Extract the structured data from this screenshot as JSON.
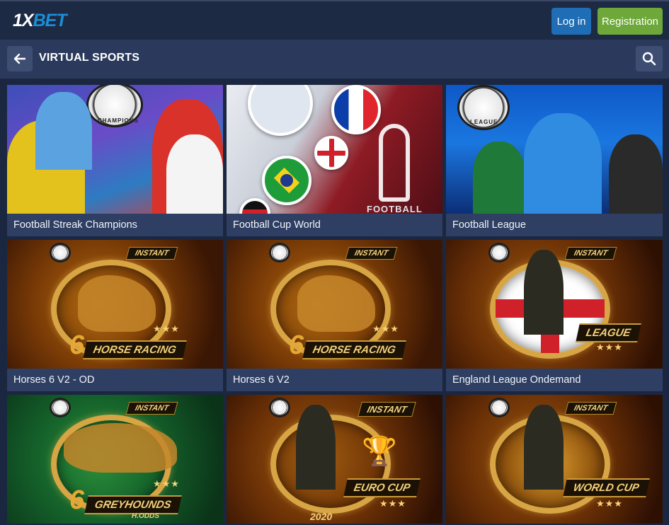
{
  "header": {
    "logo_text_primary": "1X",
    "logo_text_accent": "BET",
    "login_label": "Log in",
    "register_label": "Registration"
  },
  "subheader": {
    "title": "VIRTUAL SPORTS"
  },
  "colors": {
    "background": "#1b2740",
    "topbar": "#1d2a44",
    "subbar": "#2b3a5c",
    "caption_bg": "#2e3f63",
    "login_button": "#1f6db4",
    "register_button": "#6ea83a"
  },
  "icons": {
    "back": "arrow-left-icon",
    "search": "search-icon"
  },
  "games": [
    {
      "title": "Football Streak Champions",
      "badge_text": "CHAMPIONS"
    },
    {
      "title": "Football Cup World",
      "art_text": "FOOTBALL"
    },
    {
      "title": "Football League",
      "badge_text": "LEAGUE"
    },
    {
      "title": "Horses 6 V2 - OD",
      "art_tag": "INSTANT",
      "art_number": "6",
      "art_title": "HORSE RACING",
      "art_stars": "★★★"
    },
    {
      "title": "Horses 6 V2",
      "art_tag": "INSTANT",
      "art_number": "6",
      "art_title": "HORSE RACING",
      "art_stars": "★★★"
    },
    {
      "title": "England League Ondemand",
      "art_tag": "INSTANT",
      "art_title": "LEAGUE",
      "art_stars": "★★★"
    },
    {
      "title": "",
      "art_tag": "INSTANT",
      "art_number": "6",
      "art_title": "GREYHOUNDS",
      "art_stars": "★★★",
      "art_sub": "H.ODDS"
    },
    {
      "title": "",
      "art_tag": "INSTANT",
      "art_title": "EURO CUP",
      "art_stars": "★★★",
      "art_sub": "2020"
    },
    {
      "title": "",
      "art_tag": "INSTANT",
      "art_title": "WORLD CUP",
      "art_stars": "★★★"
    }
  ]
}
